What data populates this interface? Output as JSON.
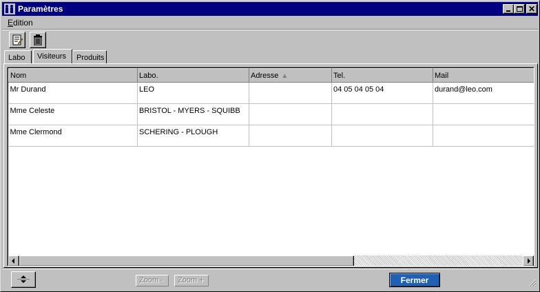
{
  "window": {
    "title": "Paramètres"
  },
  "menu": {
    "items": [
      {
        "label_first": "E",
        "label_rest": "dition"
      }
    ]
  },
  "toolbar": {
    "buttons": [
      {
        "icon": "edit-document-icon"
      },
      {
        "icon": "trash-icon"
      }
    ]
  },
  "tabs": [
    {
      "label": "Labo"
    },
    {
      "label": "Visiteurs"
    },
    {
      "label": "Produits"
    }
  ],
  "table": {
    "columns": [
      "Nom",
      "Labo.",
      "Adresse",
      "Tel.",
      "Mail"
    ],
    "rows": [
      [
        "Mr Durand",
        "LEO",
        "",
        "04 05 04 05 04",
        "durand@leo.com"
      ],
      [
        "Mme Celeste",
        "BRISTOL - MYERS - SQUIBB",
        "",
        "",
        ""
      ],
      [
        "Mme Clermond",
        "SCHERING - PLOUGH",
        "",
        "",
        ""
      ]
    ],
    "sort_indicator": "▲"
  },
  "footer": {
    "zoom_minus": "Zoom -",
    "zoom_plus": "Zoom +",
    "close": "Fermer"
  },
  "colors": {
    "titlebar": "#000080",
    "primary_button": "#2060b0"
  }
}
